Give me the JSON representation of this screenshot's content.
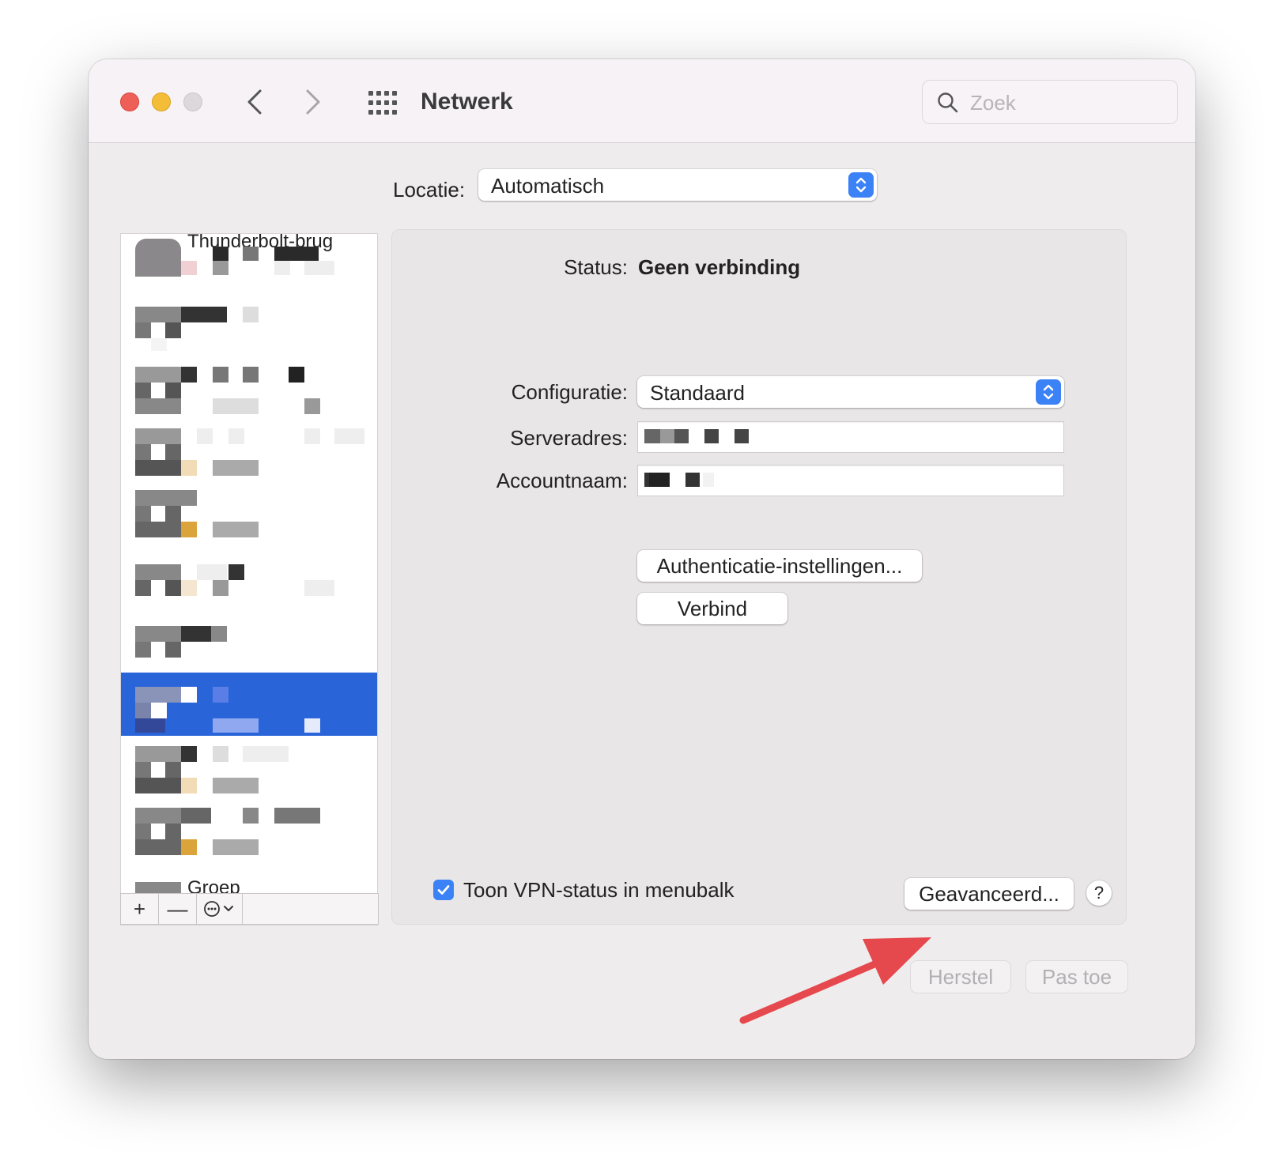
{
  "window": {
    "title": "Netwerk",
    "search_placeholder": "Zoek"
  },
  "location": {
    "label": "Locatie:",
    "value": "Automatisch"
  },
  "sidebar": {
    "first_item_label": "Thunderbolt-brug",
    "last_item_label": "Groep",
    "toolbar": {
      "add": "+",
      "remove": "—"
    }
  },
  "detail": {
    "status_label": "Status:",
    "status_value": "Geen verbinding",
    "config_label": "Configuratie:",
    "config_value": "Standaard",
    "server_label": "Serveradres:",
    "account_label": "Accountnaam:",
    "auth_button": "Authenticatie-instellingen...",
    "connect_button": "Verbind",
    "show_vpn_label": "Toon VPN-status in menubalk",
    "show_vpn_checked": true,
    "advanced_button": "Geavanceerd...",
    "help_button": "?"
  },
  "footer": {
    "revert_button": "Herstel",
    "apply_button": "Pas toe"
  },
  "colors": {
    "accent": "#3b82f6",
    "selection": "#2964d9",
    "annotation_arrow": "#e5484d"
  }
}
